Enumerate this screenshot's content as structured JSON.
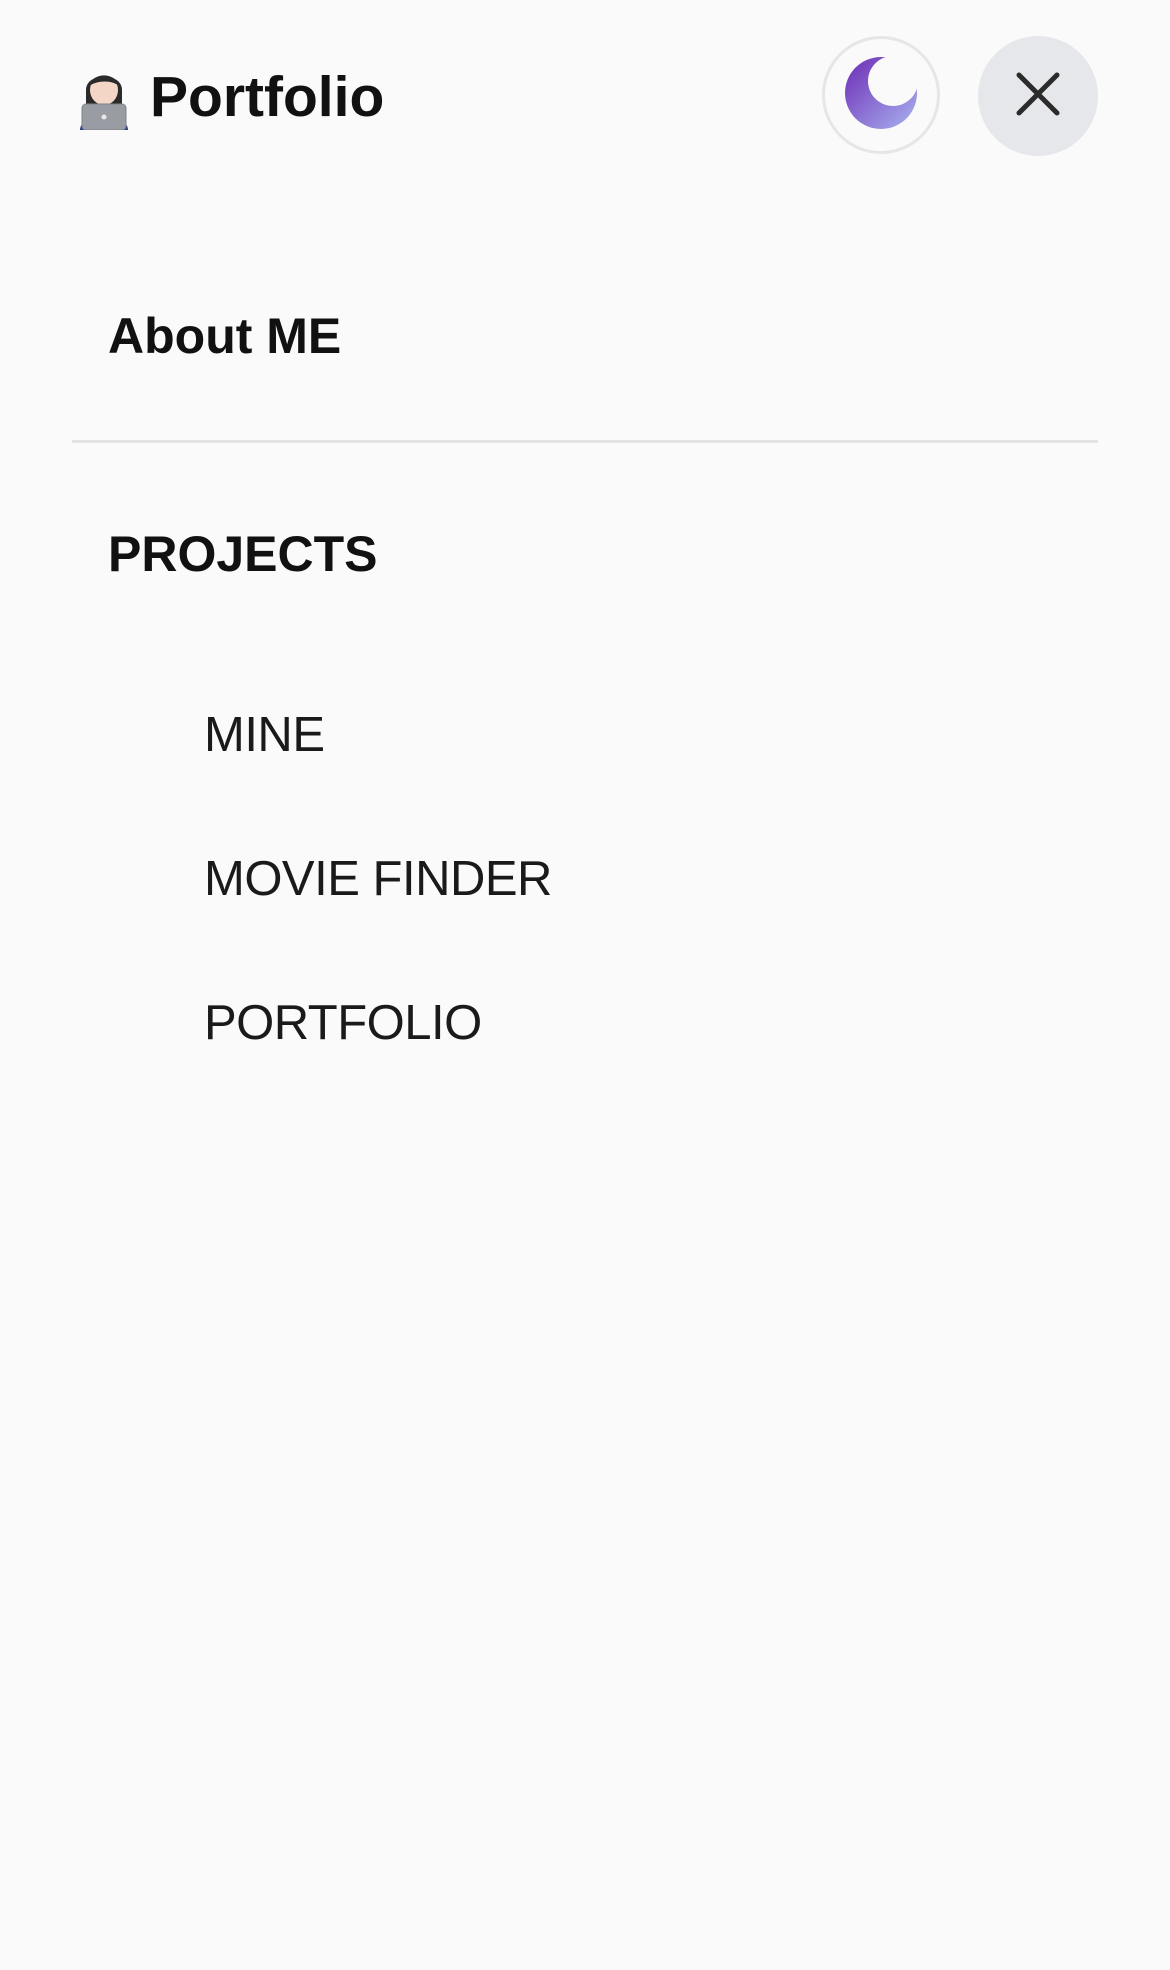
{
  "header": {
    "title": "Portfolio",
    "avatar_icon": "person-with-laptop-icon",
    "theme_toggle_icon": "moon-icon",
    "close_icon": "close-icon"
  },
  "menu": {
    "about_label": "About ME",
    "projects_label": "PROJECTS",
    "projects": [
      {
        "label": "MINE"
      },
      {
        "label": "MOVIE FINDER"
      },
      {
        "label": "PORTFOLIO"
      }
    ]
  },
  "colors": {
    "background": "#fafafa",
    "text": "#111111",
    "moon_gradient_start": "#6c2bb5",
    "moon_gradient_end": "#a9b3f0",
    "close_button_bg": "#e6e7ea"
  }
}
